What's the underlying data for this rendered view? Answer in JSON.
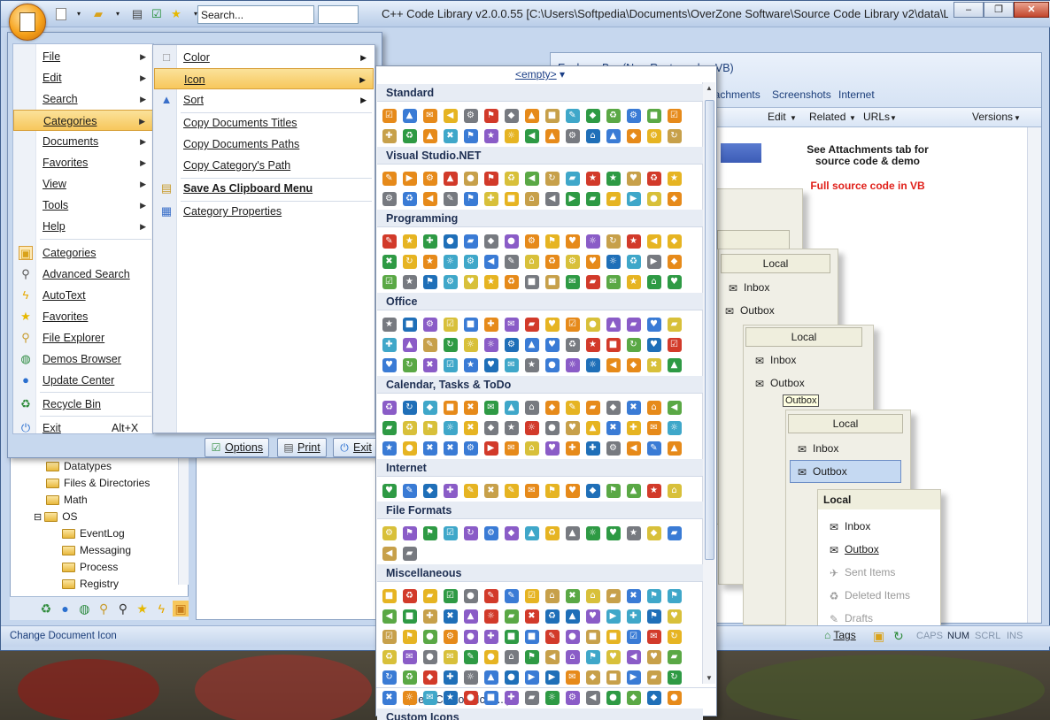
{
  "window": {
    "title": "C++ Code Library v2.0.0.55 [C:\\Users\\Softpedia\\Documents\\OverZone Software\\Source Code Library v2\\data\\Library.c...",
    "search_placeholder": "Search...",
    "controls": [
      "–",
      "❐",
      "✕"
    ]
  },
  "app_menu": {
    "items": [
      {
        "label": "File",
        "submenu": true
      },
      {
        "label": "Edit",
        "submenu": true
      },
      {
        "label": "Search",
        "submenu": true
      },
      {
        "label": "Categories",
        "submenu": true,
        "highlighted": true
      },
      {
        "label": "Documents",
        "submenu": true
      },
      {
        "label": "Favorites",
        "submenu": true
      },
      {
        "label": "View",
        "submenu": true
      },
      {
        "label": "Tools",
        "submenu": true
      },
      {
        "label": "Help",
        "submenu": true
      }
    ],
    "panes": [
      {
        "label": "Categories",
        "icon": "categories-icon"
      },
      {
        "label": "Advanced Search",
        "icon": "search-icon"
      },
      {
        "label": "AutoText",
        "icon": "lightning-icon"
      },
      {
        "label": "Favorites",
        "icon": "star-icon"
      },
      {
        "label": "File Explorer",
        "icon": "explorer-icon"
      },
      {
        "label": "Demos Browser",
        "icon": "globe-icon"
      },
      {
        "label": "Update Center",
        "icon": "update-icon"
      }
    ],
    "recycle_bin": "Recycle Bin",
    "exit": {
      "label": "Exit",
      "shortcut": "Alt+X"
    },
    "bottom_buttons": {
      "options": "Options",
      "print": "Print",
      "exit": "Exit"
    }
  },
  "submenu": {
    "items": [
      "Color",
      "Icon",
      "Sort",
      "Copy Documents Titles",
      "Copy Documents Paths",
      "Copy Category's Path",
      "Save As Clipboard Menu",
      "Category Properties"
    ]
  },
  "icon_picker": {
    "empty_label": "<empty>",
    "sections": [
      {
        "title": "Standard",
        "count": 31
      },
      {
        "title": "Visual Studio.NET",
        "count": 30
      },
      {
        "title": "Programming",
        "count": 46
      },
      {
        "title": "Office",
        "count": 46
      },
      {
        "title": "Calendar, Tasks & ToDo",
        "count": 46
      },
      {
        "title": "Internet",
        "count": 15
      },
      {
        "title": "File Formats",
        "count": 17
      },
      {
        "title": "Miscellaneous",
        "count": 91
      },
      {
        "title": "Custom Icons",
        "count": 0
      }
    ],
    "new_custom": "(New Custom Icon...)"
  },
  "tree": {
    "items": [
      {
        "label": "Datatypes",
        "indent": 1
      },
      {
        "label": "Files & Directories",
        "indent": 1
      },
      {
        "label": "Math",
        "indent": 1
      },
      {
        "label": "OS",
        "indent": 0,
        "toggle": "⊟"
      },
      {
        "label": "EventLog",
        "indent": 2
      },
      {
        "label": "Messaging",
        "indent": 2
      },
      {
        "label": "Process",
        "indent": 2
      },
      {
        "label": "Registry",
        "indent": 2
      }
    ]
  },
  "document": {
    "title": "Explorer Bar (Non-Rectangular, VB)",
    "tabs": [
      "Attachments",
      "Screenshots",
      "Internet"
    ],
    "toolbar": [
      "Edit",
      "Related",
      "URLs",
      "Versions"
    ],
    "note_line1": "See Attachments tab for",
    "note_line2": "source code & demo",
    "note_red": "Full source code in VB"
  },
  "preview": {
    "local": "Local",
    "inbox": "Inbox",
    "outbox": "Outbox",
    "sent": "Sent Items",
    "deleted": "Deleted Items",
    "drafts": "Drafts",
    "tooltip": "Outbox"
  },
  "statusbar": {
    "left": "Change Document Icon",
    "tags": "Tags",
    "indicators": [
      "CAPS",
      "NUM",
      "SCRL",
      "INS"
    ]
  }
}
